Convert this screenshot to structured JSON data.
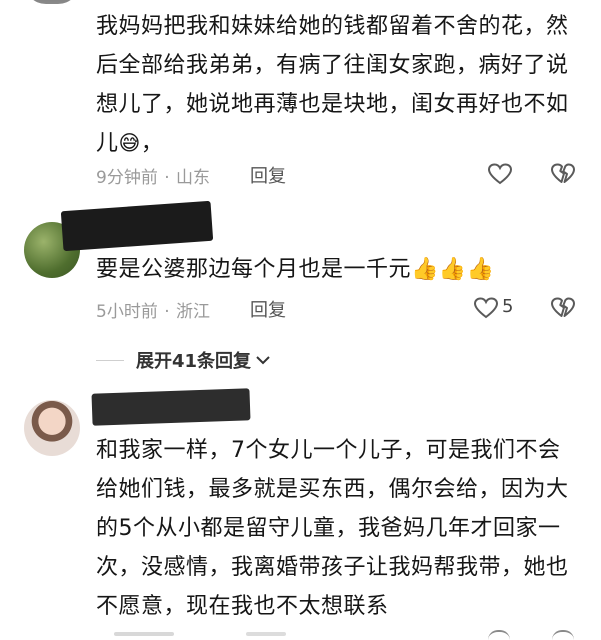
{
  "comments": [
    {
      "text_lines": [
        "我妈妈把我和妹妹给她的钱都留着不舍的花，然",
        "后全部给我弟弟，有病了往闺女家跑，病好了说",
        "想儿了，她说地再薄也是块地，闺女再好也不如"
      ],
      "last_line_text": "儿",
      "last_line_emoji": "😅",
      "last_line_after": "，",
      "time": "9分钟前",
      "location": "山东",
      "reply_label": "回复",
      "like_count": ""
    },
    {
      "text": "要是公婆那边每个月也是一千元",
      "emojis": [
        "👍",
        "👍",
        "👍"
      ],
      "time": "5小时前",
      "location": "浙江",
      "reply_label": "回复",
      "like_count": "5"
    },
    {
      "text_lines": [
        "和我家一样，7个女儿一个儿子，可是我们不会",
        "给她们钱，最多就是买东西，偶尔会给，因为大",
        "的5个从小都是留守儿童，我爸妈几年才回家一",
        "次，没感情，我离婚带孩子让我妈帮我带，她也",
        "不愿意，现在我也不太想联系"
      ]
    }
  ],
  "expand_replies": {
    "label": "展开41条回复",
    "chevron": "chevron-down-icon"
  },
  "meta_separator": "·",
  "colors": {
    "text": "#161616",
    "meta": "#9a9a9a",
    "icon": "#6a6a6a"
  }
}
